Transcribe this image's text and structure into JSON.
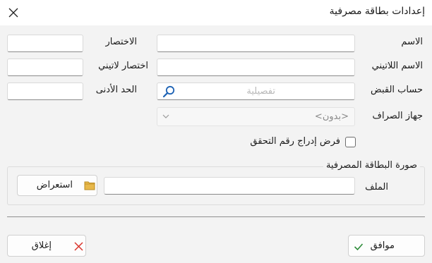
{
  "window": {
    "title": "إعدادات بطاقة مصرفية"
  },
  "form": {
    "name_label": "الاسم",
    "latin_name_label": "الاسم اللاتيني",
    "short_label": "الاختصار",
    "latin_short_label": "اختصار لاتيني",
    "account_label": "حساب القبض",
    "min_label": "الحد الأدنى",
    "account_placeholder": "تفصيلية",
    "device_label": "جهاز الصراف",
    "device_value": "<بدون>",
    "force_check_label": "فرض إدراج رقم التحقق"
  },
  "card_image": {
    "group_title": "صورة البطاقة المصرفية",
    "file_label": "الملف",
    "browse_label": "استعراض"
  },
  "buttons": {
    "ok_label": "موافق",
    "close_label": "إغلاق"
  },
  "icons": {
    "close": "close-icon",
    "search": "search-icon",
    "chevron": "chevron-down-icon",
    "folder": "folder-icon",
    "check": "check-icon",
    "cancel": "cancel-x-icon"
  },
  "colors": {
    "folder": "#e8b84a",
    "check": "#2e8b3a",
    "cancel": "#d9342b",
    "search": "#1e63b5"
  }
}
